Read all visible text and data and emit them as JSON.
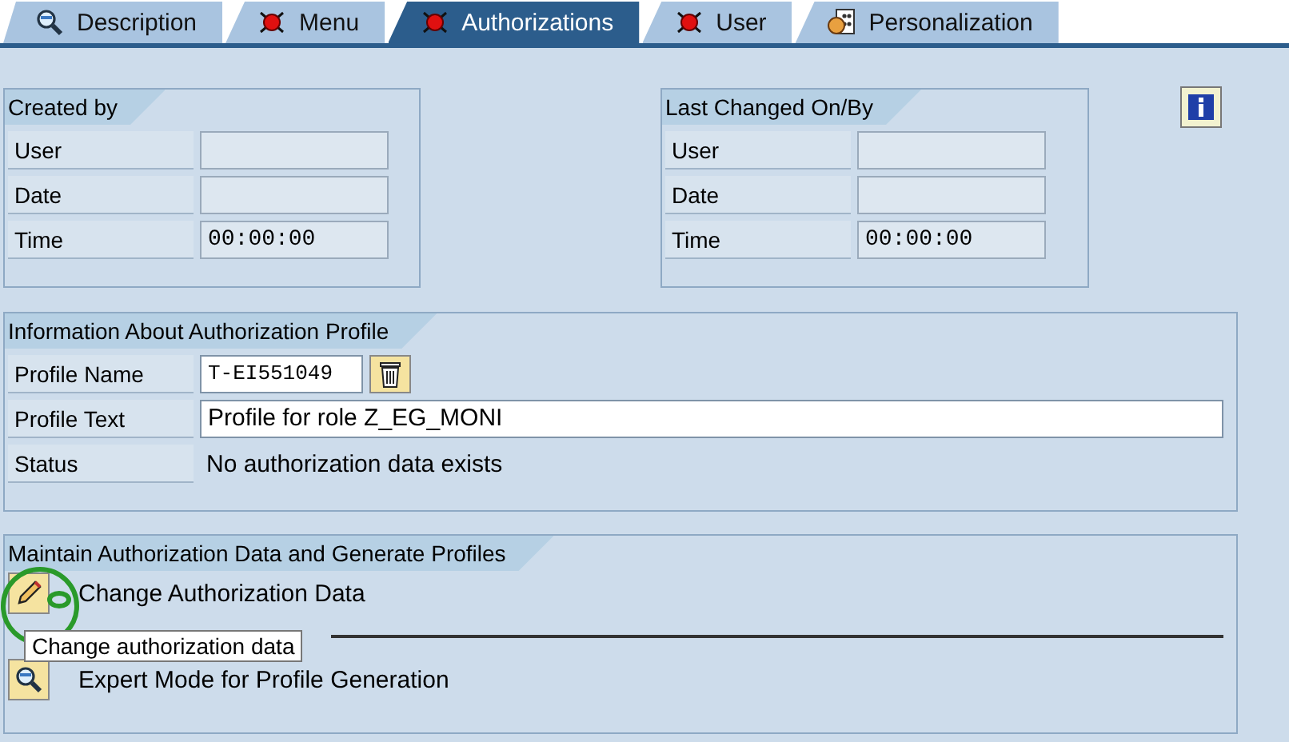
{
  "tabs": [
    {
      "label": "Description",
      "selected": false,
      "kind": "search"
    },
    {
      "label": "Menu",
      "selected": false,
      "kind": "status"
    },
    {
      "label": "Authorizations",
      "selected": true,
      "kind": "status"
    },
    {
      "label": "User",
      "selected": false,
      "kind": "status"
    },
    {
      "label": "Personalization",
      "selected": false,
      "kind": "personalization"
    }
  ],
  "created_by": {
    "title": "Created by",
    "fields": [
      {
        "label": "User"
      },
      {
        "label": "Date"
      },
      {
        "label": "Time",
        "value": "00:00:00"
      }
    ]
  },
  "last_changed": {
    "title": "Last Changed On/By",
    "fields": [
      {
        "label": "User"
      },
      {
        "label": "Date"
      },
      {
        "label": "Time",
        "value": "00:00:00"
      }
    ]
  },
  "profile": {
    "title": "Information About Authorization Profile",
    "rows": [
      {
        "kind": "short_field",
        "label": "Profile Name",
        "value": "T-EI551049",
        "delete_button": true
      },
      {
        "kind": "long_field",
        "label": "Profile Text",
        "value": "Profile for role Z_EG_MONI"
      },
      {
        "kind": "text",
        "label": "Status",
        "value": "No authorization data exists"
      }
    ]
  },
  "maintain": {
    "title": "Maintain Authorization Data and Generate Profiles",
    "actions": [
      {
        "label": "Change Authorization Data",
        "kind": "edit",
        "tooltip": "Change authorization data"
      },
      {
        "label": "Expert Mode for Profile Generation",
        "kind": "expert"
      }
    ]
  }
}
